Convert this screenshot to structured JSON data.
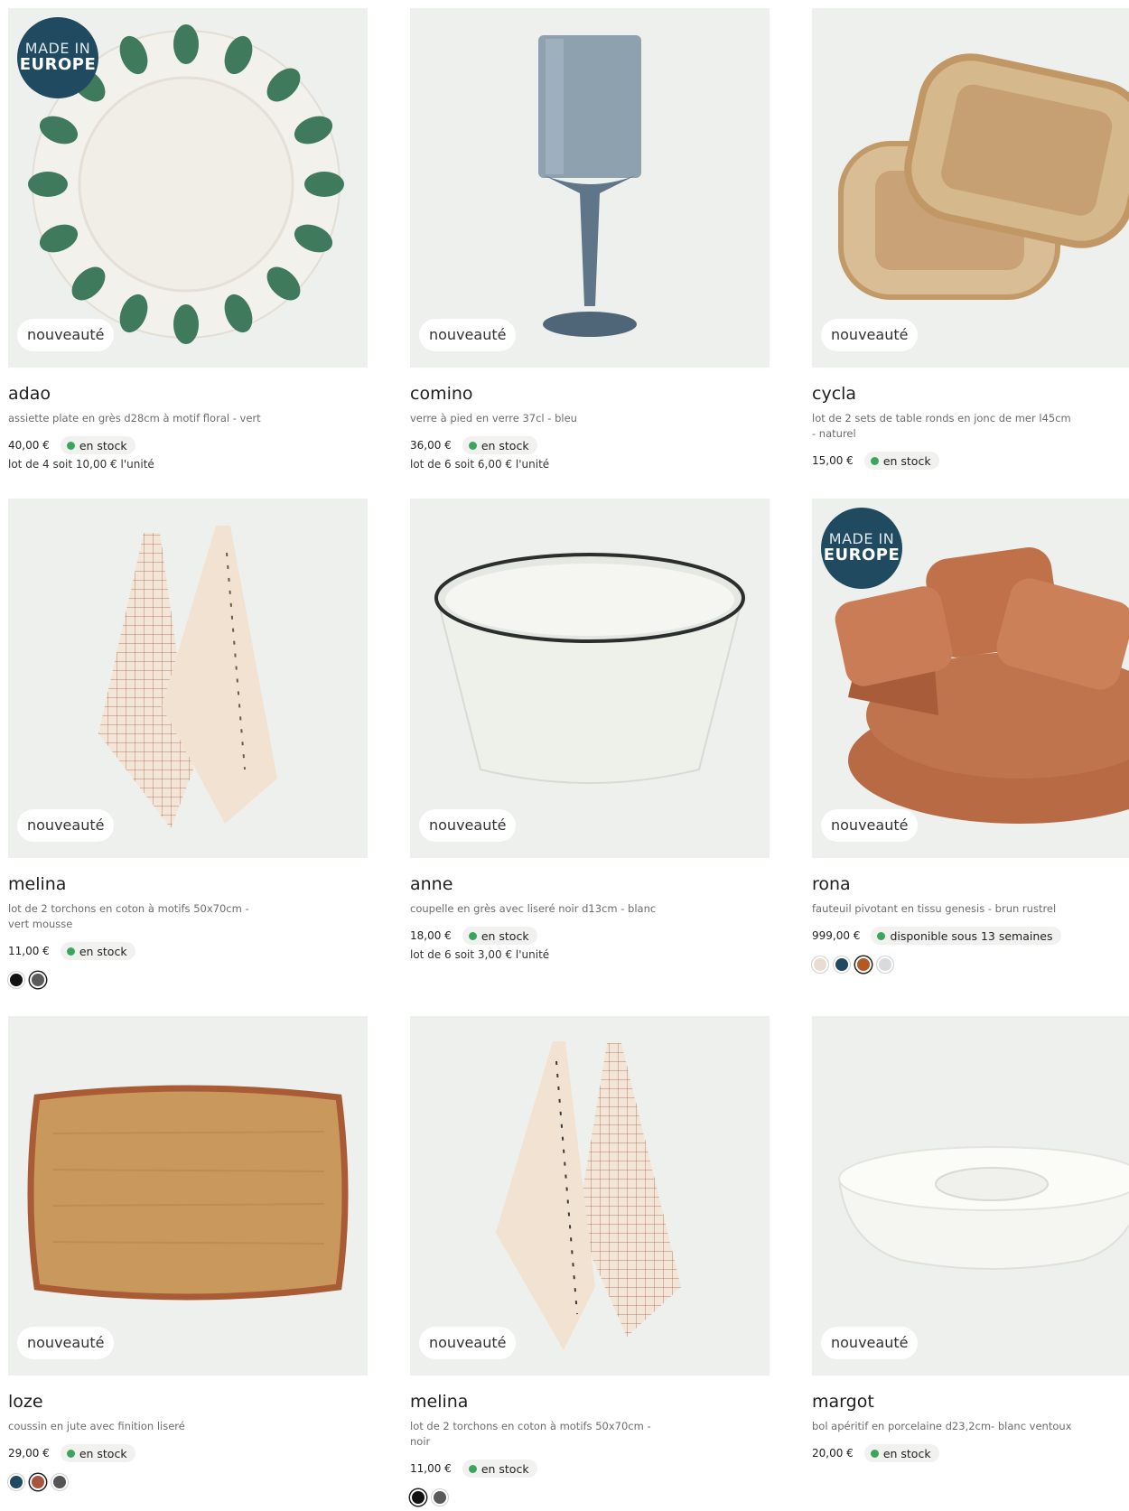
{
  "badges": {
    "new": "nouveauté",
    "made_line1": "MADE IN",
    "made_line2": "EUROPE"
  },
  "colors": {
    "stock_dot": "#3aa55d",
    "badge_made_bg": "#1f4a5f",
    "image_bg": "#eef0ed"
  },
  "products": [
    {
      "name": "adao",
      "desc": "assiette plate en grès d28cm à motif floral - vert",
      "price": "40,00 €",
      "stock": "en stock",
      "lot": "lot de 4 soit 10,00 € l'unité",
      "made_in_europe": true,
      "swatches": []
    },
    {
      "name": "comino",
      "desc": "verre à pied en verre 37cl - bleu",
      "price": "36,00 €",
      "stock": "en stock",
      "lot": "lot de 6 soit 6,00 € l'unité",
      "made_in_europe": false,
      "swatches": []
    },
    {
      "name": "cycla",
      "desc": "lot de 2 sets de table ronds en jonc de mer l45cm - naturel",
      "price": "15,00 €",
      "stock": "en stock",
      "lot": "",
      "made_in_europe": false,
      "swatches": []
    },
    {
      "name": "melina",
      "desc": "lot de 2 torchons en coton à motifs 50x70cm - vert mousse",
      "price": "11,00 €",
      "stock": "en stock",
      "lot": "",
      "made_in_europe": false,
      "swatches": [
        "#111111",
        "#5a5a5a"
      ]
    },
    {
      "name": "anne",
      "desc": "coupelle en grès avec liseré noir d13cm - blanc",
      "price": "18,00 €",
      "stock": "en stock",
      "lot": "lot de 6 soit 3,00 € l'unité",
      "made_in_europe": false,
      "swatches": []
    },
    {
      "name": "rona",
      "desc": "fauteuil pivotant en tissu genesis - brun rustrel",
      "price": "999,00 €",
      "stock": "disponible sous 13 semaines",
      "lot": "",
      "made_in_europe": true,
      "swatches": [
        "#e9ddd2",
        "#1f4a5f",
        "#b35a24",
        "#d9dadc"
      ]
    },
    {
      "name": "loze",
      "desc": "coussin en jute avec finition liseré",
      "price": "29,00 €",
      "stock": "en stock",
      "lot": "",
      "made_in_europe": false,
      "swatches": [
        "#1f4a5f",
        "#a9543c",
        "#555555"
      ]
    },
    {
      "name": "melina",
      "desc": "lot de 2 torchons en coton à motifs 50x70cm - noir",
      "price": "11,00 €",
      "stock": "en stock",
      "lot": "",
      "made_in_europe": false,
      "swatches": [
        "#111111",
        "#5a5a5a"
      ]
    },
    {
      "name": "margot",
      "desc": "bol apéritif en porcelaine d23,2cm- blanc ventoux",
      "price": "20,00 €",
      "stock": "en stock",
      "lot": "",
      "made_in_europe": false,
      "swatches": []
    }
  ]
}
